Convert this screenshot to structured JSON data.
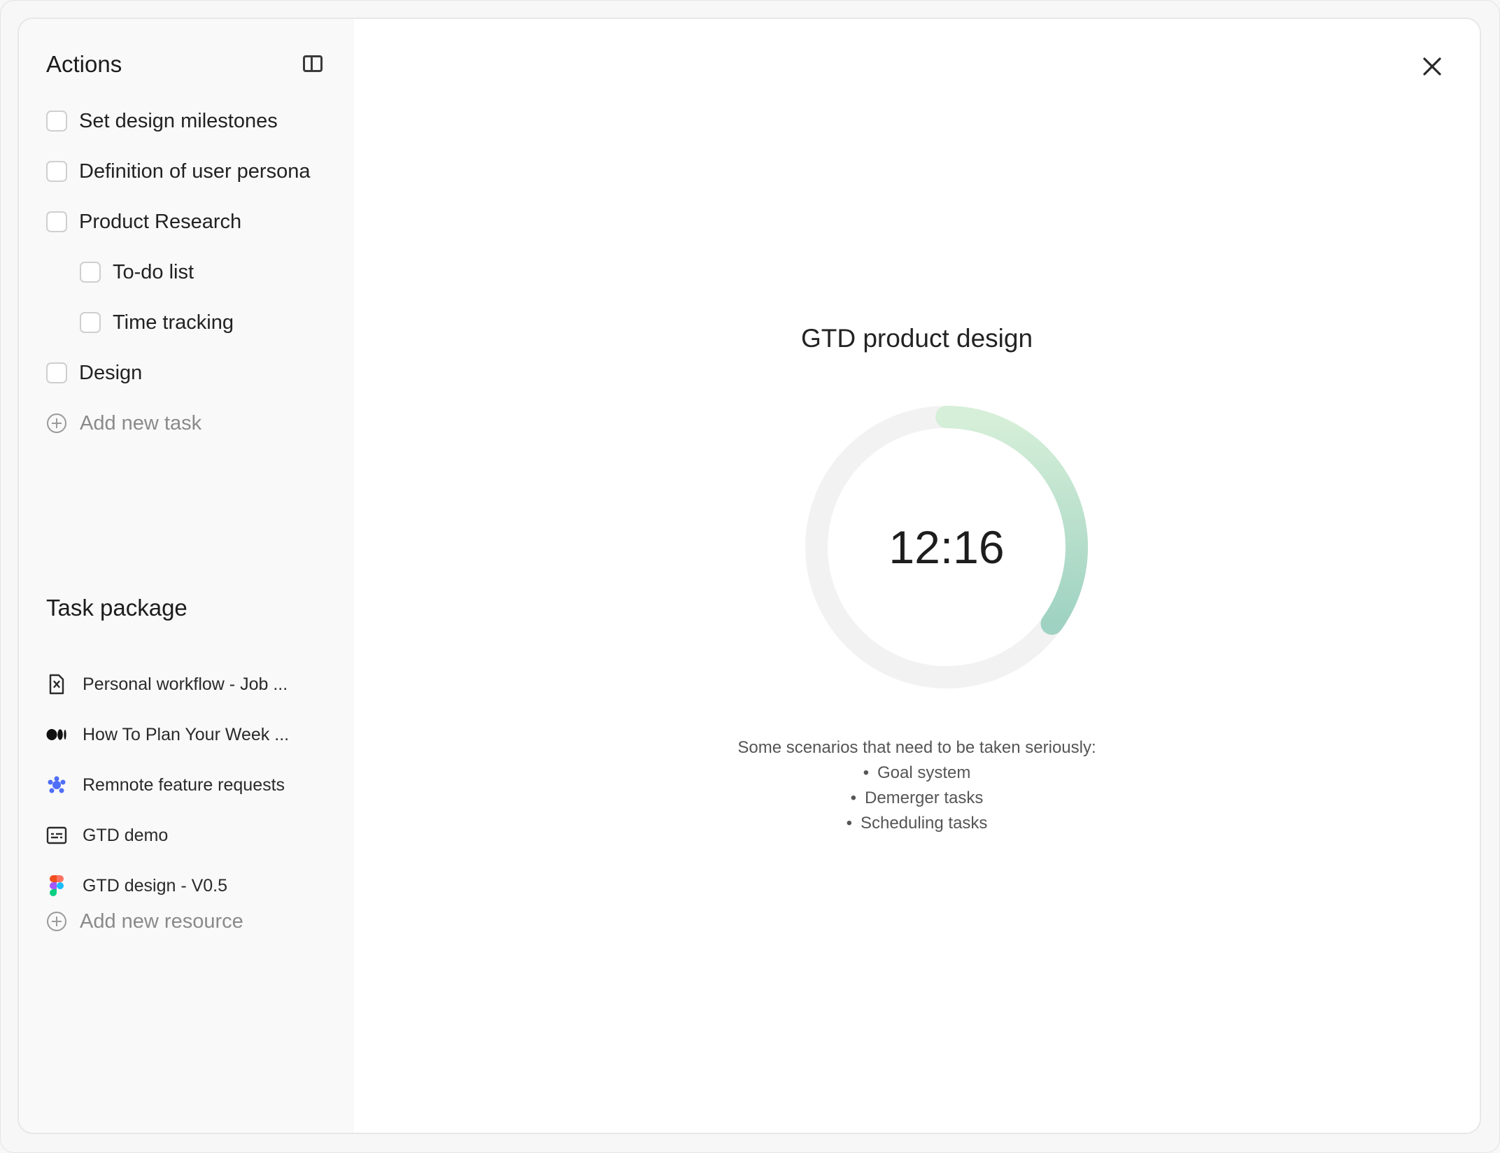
{
  "actions": {
    "title": "Actions",
    "tasks": [
      {
        "label": "Set design milestones",
        "checked": false
      },
      {
        "label": "Definition of user persona",
        "checked": false
      },
      {
        "label": "Product Research",
        "checked": false
      },
      {
        "label": "To-do list",
        "checked": false,
        "subtask": true
      },
      {
        "label": "Time tracking",
        "checked": false,
        "subtask": true
      },
      {
        "label": "Design",
        "checked": false
      }
    ],
    "add_task_label": "Add new task"
  },
  "task_package": {
    "title": "Task package",
    "resources": [
      {
        "label": "Personal workflow - Job ...",
        "icon": "spreadsheet-file-icon"
      },
      {
        "label": "How To Plan Your Week ...",
        "icon": "medium-icon"
      },
      {
        "label": "Remnote feature requests",
        "icon": "remnote-icon"
      },
      {
        "label": "GTD demo",
        "icon": "document-card-icon"
      },
      {
        "label": "GTD design - V0.5",
        "icon": "figma-icon"
      }
    ],
    "add_resource_label": "Add new resource"
  },
  "timer": {
    "title": "GTD product design",
    "time": "12:16",
    "progress": 0.35,
    "colors": {
      "track": "#f2f2f2",
      "arc_start": "#d6efd8",
      "arc_end": "#9fd2c2"
    }
  },
  "notes": {
    "intro": "Some scenarios that need to be taken seriously:",
    "items": [
      "Goal system",
      "Demerger tasks",
      "Scheduling tasks"
    ]
  }
}
